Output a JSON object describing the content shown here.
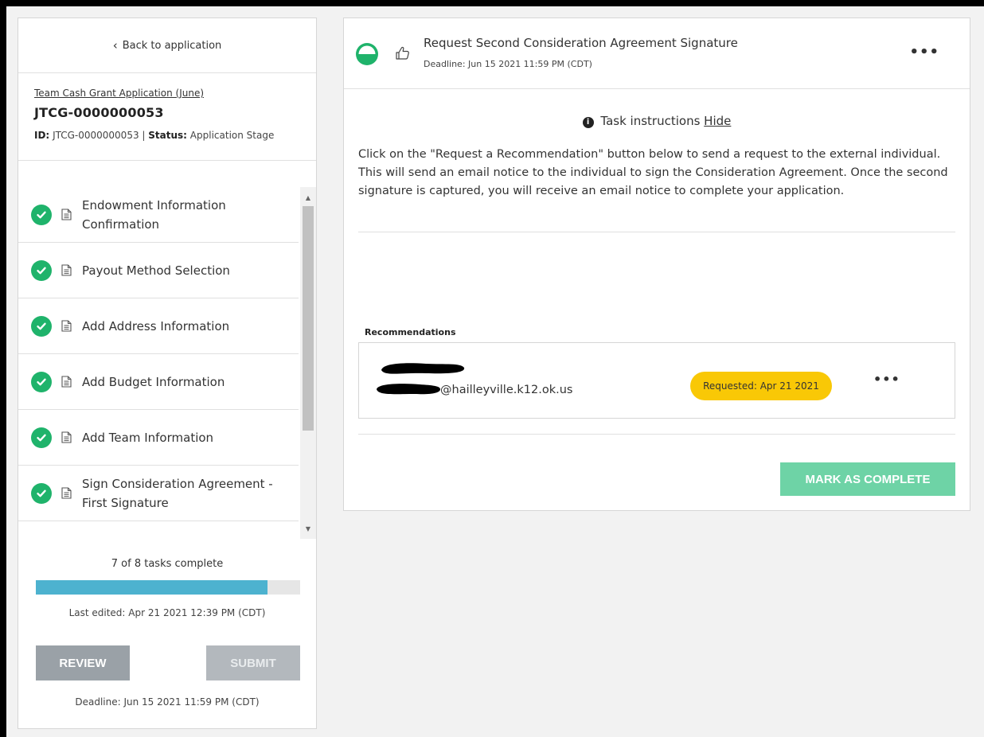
{
  "sidebar": {
    "back_label": "Back to application",
    "app_name": "Team Cash Grant Application (June)",
    "app_code": "JTCG-0000000053",
    "meta_id_label": "ID:",
    "meta_id_value": "JTCG-0000000053",
    "meta_status_label": "Status:",
    "meta_status_value": "Application Stage",
    "tasks": [
      {
        "label": "Endowment Information Confirmation",
        "status": "complete"
      },
      {
        "label": "Payout Method Selection",
        "status": "complete"
      },
      {
        "label": "Add Address Information",
        "status": "complete"
      },
      {
        "label": "Add Budget Information",
        "status": "complete"
      },
      {
        "label": "Add Team Information",
        "status": "complete"
      },
      {
        "label": "Sign Consideration Agreement - First Signature",
        "status": "complete"
      }
    ],
    "progress_text": "7 of 8 tasks complete",
    "progress_fraction": 0.875,
    "last_edited": "Last edited: Apr 21 2021 12:39 PM (CDT)",
    "review_label": "REVIEW",
    "submit_label": "SUBMIT",
    "deadline": "Deadline: Jun 15 2021 11:59 PM (CDT)"
  },
  "task_panel": {
    "title": "Request Second Consideration Agreement Signature",
    "deadline": "Deadline: Jun 15 2021 11:59 PM (CDT)",
    "more_label": "•••",
    "instructions_heading": "Task instructions",
    "hide_label": "Hide",
    "instructions_body": "Click on the \"Request a Recommendation\" button below to send a request to the external individual. This will send an email notice to the individual to sign the Consideration Agreement. Once the second signature is captured, you will receive an email notice to complete your application.",
    "recommendations_label": "Recommendations",
    "recommendation": {
      "email_suffix": "@hailleyville.k12.ok.us",
      "badge": "Requested: Apr 21 2021",
      "more_label": "•••"
    },
    "complete_label": "MARK AS COMPLETE"
  },
  "colors": {
    "check_green": "#1fb36b",
    "progress_blue": "#4db2cf",
    "badge_yellow": "#f9c806",
    "complete_button": "#6ed3a6",
    "review_button": "#9aa1a7"
  },
  "icons": [
    "chevron-left-icon",
    "check-circle-icon",
    "document-icon",
    "half-circle-status-icon",
    "thumbs-up-icon",
    "info-icon",
    "more-icon"
  ]
}
